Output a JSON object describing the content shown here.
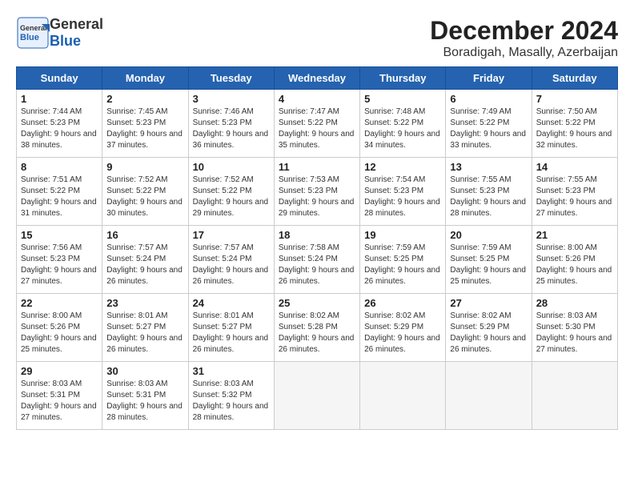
{
  "logo": {
    "text_general": "General",
    "text_blue": "Blue"
  },
  "header": {
    "month": "December 2024",
    "location": "Boradigah, Masally, Azerbaijan"
  },
  "weekdays": [
    "Sunday",
    "Monday",
    "Tuesday",
    "Wednesday",
    "Thursday",
    "Friday",
    "Saturday"
  ],
  "weeks": [
    [
      {
        "day": "1",
        "sunrise": "Sunrise: 7:44 AM",
        "sunset": "Sunset: 5:23 PM",
        "daylight": "Daylight: 9 hours and 38 minutes."
      },
      {
        "day": "2",
        "sunrise": "Sunrise: 7:45 AM",
        "sunset": "Sunset: 5:23 PM",
        "daylight": "Daylight: 9 hours and 37 minutes."
      },
      {
        "day": "3",
        "sunrise": "Sunrise: 7:46 AM",
        "sunset": "Sunset: 5:23 PM",
        "daylight": "Daylight: 9 hours and 36 minutes."
      },
      {
        "day": "4",
        "sunrise": "Sunrise: 7:47 AM",
        "sunset": "Sunset: 5:22 PM",
        "daylight": "Daylight: 9 hours and 35 minutes."
      },
      {
        "day": "5",
        "sunrise": "Sunrise: 7:48 AM",
        "sunset": "Sunset: 5:22 PM",
        "daylight": "Daylight: 9 hours and 34 minutes."
      },
      {
        "day": "6",
        "sunrise": "Sunrise: 7:49 AM",
        "sunset": "Sunset: 5:22 PM",
        "daylight": "Daylight: 9 hours and 33 minutes."
      },
      {
        "day": "7",
        "sunrise": "Sunrise: 7:50 AM",
        "sunset": "Sunset: 5:22 PM",
        "daylight": "Daylight: 9 hours and 32 minutes."
      }
    ],
    [
      {
        "day": "8",
        "sunrise": "Sunrise: 7:51 AM",
        "sunset": "Sunset: 5:22 PM",
        "daylight": "Daylight: 9 hours and 31 minutes."
      },
      {
        "day": "9",
        "sunrise": "Sunrise: 7:52 AM",
        "sunset": "Sunset: 5:22 PM",
        "daylight": "Daylight: 9 hours and 30 minutes."
      },
      {
        "day": "10",
        "sunrise": "Sunrise: 7:52 AM",
        "sunset": "Sunset: 5:22 PM",
        "daylight": "Daylight: 9 hours and 29 minutes."
      },
      {
        "day": "11",
        "sunrise": "Sunrise: 7:53 AM",
        "sunset": "Sunset: 5:23 PM",
        "daylight": "Daylight: 9 hours and 29 minutes."
      },
      {
        "day": "12",
        "sunrise": "Sunrise: 7:54 AM",
        "sunset": "Sunset: 5:23 PM",
        "daylight": "Daylight: 9 hours and 28 minutes."
      },
      {
        "day": "13",
        "sunrise": "Sunrise: 7:55 AM",
        "sunset": "Sunset: 5:23 PM",
        "daylight": "Daylight: 9 hours and 28 minutes."
      },
      {
        "day": "14",
        "sunrise": "Sunrise: 7:55 AM",
        "sunset": "Sunset: 5:23 PM",
        "daylight": "Daylight: 9 hours and 27 minutes."
      }
    ],
    [
      {
        "day": "15",
        "sunrise": "Sunrise: 7:56 AM",
        "sunset": "Sunset: 5:23 PM",
        "daylight": "Daylight: 9 hours and 27 minutes."
      },
      {
        "day": "16",
        "sunrise": "Sunrise: 7:57 AM",
        "sunset": "Sunset: 5:24 PM",
        "daylight": "Daylight: 9 hours and 26 minutes."
      },
      {
        "day": "17",
        "sunrise": "Sunrise: 7:57 AM",
        "sunset": "Sunset: 5:24 PM",
        "daylight": "Daylight: 9 hours and 26 minutes."
      },
      {
        "day": "18",
        "sunrise": "Sunrise: 7:58 AM",
        "sunset": "Sunset: 5:24 PM",
        "daylight": "Daylight: 9 hours and 26 minutes."
      },
      {
        "day": "19",
        "sunrise": "Sunrise: 7:59 AM",
        "sunset": "Sunset: 5:25 PM",
        "daylight": "Daylight: 9 hours and 26 minutes."
      },
      {
        "day": "20",
        "sunrise": "Sunrise: 7:59 AM",
        "sunset": "Sunset: 5:25 PM",
        "daylight": "Daylight: 9 hours and 25 minutes."
      },
      {
        "day": "21",
        "sunrise": "Sunrise: 8:00 AM",
        "sunset": "Sunset: 5:26 PM",
        "daylight": "Daylight: 9 hours and 25 minutes."
      }
    ],
    [
      {
        "day": "22",
        "sunrise": "Sunrise: 8:00 AM",
        "sunset": "Sunset: 5:26 PM",
        "daylight": "Daylight: 9 hours and 25 minutes."
      },
      {
        "day": "23",
        "sunrise": "Sunrise: 8:01 AM",
        "sunset": "Sunset: 5:27 PM",
        "daylight": "Daylight: 9 hours and 26 minutes."
      },
      {
        "day": "24",
        "sunrise": "Sunrise: 8:01 AM",
        "sunset": "Sunset: 5:27 PM",
        "daylight": "Daylight: 9 hours and 26 minutes."
      },
      {
        "day": "25",
        "sunrise": "Sunrise: 8:02 AM",
        "sunset": "Sunset: 5:28 PM",
        "daylight": "Daylight: 9 hours and 26 minutes."
      },
      {
        "day": "26",
        "sunrise": "Sunrise: 8:02 AM",
        "sunset": "Sunset: 5:29 PM",
        "daylight": "Daylight: 9 hours and 26 minutes."
      },
      {
        "day": "27",
        "sunrise": "Sunrise: 8:02 AM",
        "sunset": "Sunset: 5:29 PM",
        "daylight": "Daylight: 9 hours and 26 minutes."
      },
      {
        "day": "28",
        "sunrise": "Sunrise: 8:03 AM",
        "sunset": "Sunset: 5:30 PM",
        "daylight": "Daylight: 9 hours and 27 minutes."
      }
    ],
    [
      {
        "day": "29",
        "sunrise": "Sunrise: 8:03 AM",
        "sunset": "Sunset: 5:31 PM",
        "daylight": "Daylight: 9 hours and 27 minutes."
      },
      {
        "day": "30",
        "sunrise": "Sunrise: 8:03 AM",
        "sunset": "Sunset: 5:31 PM",
        "daylight": "Daylight: 9 hours and 28 minutes."
      },
      {
        "day": "31",
        "sunrise": "Sunrise: 8:03 AM",
        "sunset": "Sunset: 5:32 PM",
        "daylight": "Daylight: 9 hours and 28 minutes."
      },
      null,
      null,
      null,
      null
    ]
  ]
}
